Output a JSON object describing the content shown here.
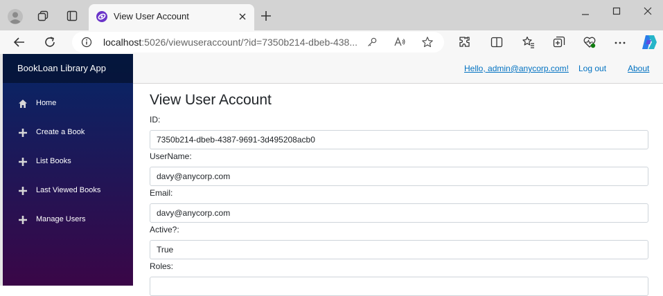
{
  "browser": {
    "tab_title": "View User Account",
    "url_host": "localhost",
    "url_rest": ":5026/viewuseraccount/?id=7350b214-dbeb-438..."
  },
  "app": {
    "brand": "BookLoan Library App",
    "nav": [
      {
        "label": "Home",
        "icon": "home-icon"
      },
      {
        "label": "Create a Book",
        "icon": "plus-icon"
      },
      {
        "label": "List Books",
        "icon": "plus-icon"
      },
      {
        "label": "Last Viewed Books",
        "icon": "plus-icon"
      },
      {
        "label": "Manage Users",
        "icon": "plus-icon"
      }
    ],
    "topbar": {
      "hello": "Hello, admin@anycorp.com!",
      "logout": "Log out",
      "about": "About"
    }
  },
  "page": {
    "title": "View User Account",
    "fields": [
      {
        "label": "ID:",
        "value": "7350b214-dbeb-4387-9691-3d495208acb0"
      },
      {
        "label": "UserName:",
        "value": "davy@anycorp.com"
      },
      {
        "label": "Email:",
        "value": "davy@anycorp.com"
      },
      {
        "label": "Active?:",
        "value": "True"
      },
      {
        "label": "Roles:",
        "value": ""
      }
    ]
  },
  "colors": {
    "link": "#0071c1",
    "sidebar_top": "#052767",
    "sidebar_bottom": "#3a0647",
    "copilot_accent": "#2b7de9"
  }
}
